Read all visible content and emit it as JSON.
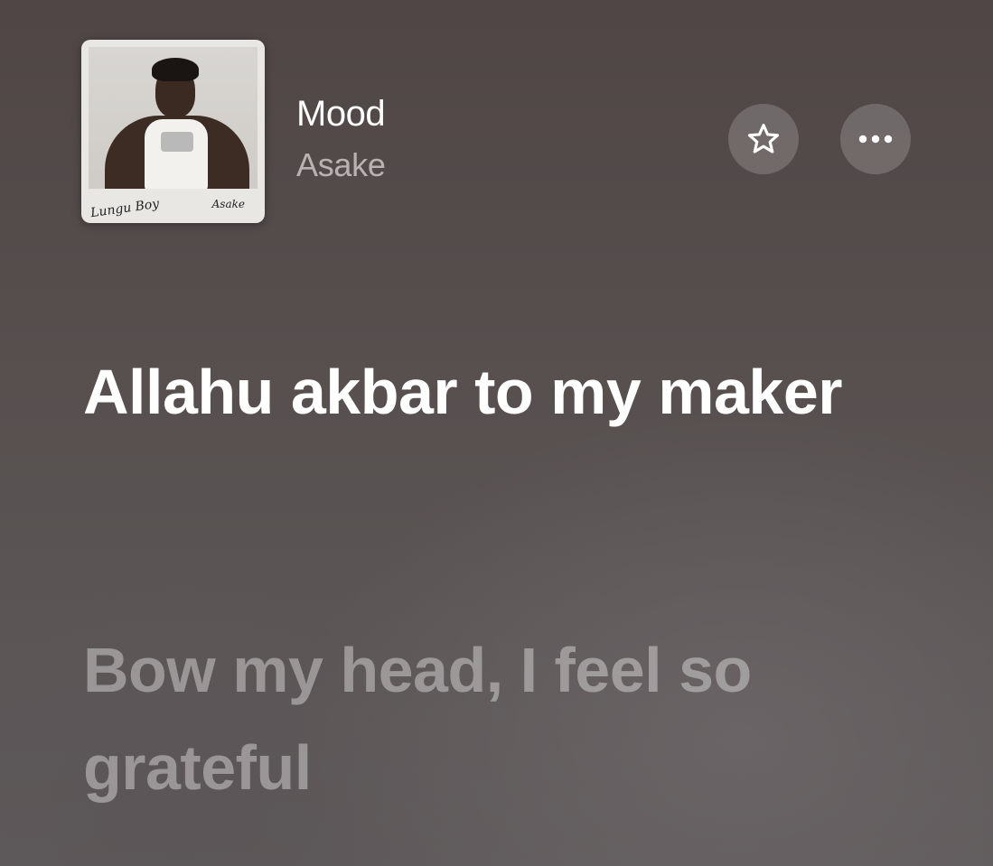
{
  "song": {
    "title": "Mood",
    "artist": "Asake",
    "artwork_signature_left": "Lungu Boy",
    "artwork_signature_right": "Asake"
  },
  "actions": {
    "favorite_icon": "star-icon",
    "more_icon": "ellipsis-icon"
  },
  "lyrics": {
    "current": "Allahu akbar to my maker",
    "next": "Bow my head, I feel so grateful"
  }
}
